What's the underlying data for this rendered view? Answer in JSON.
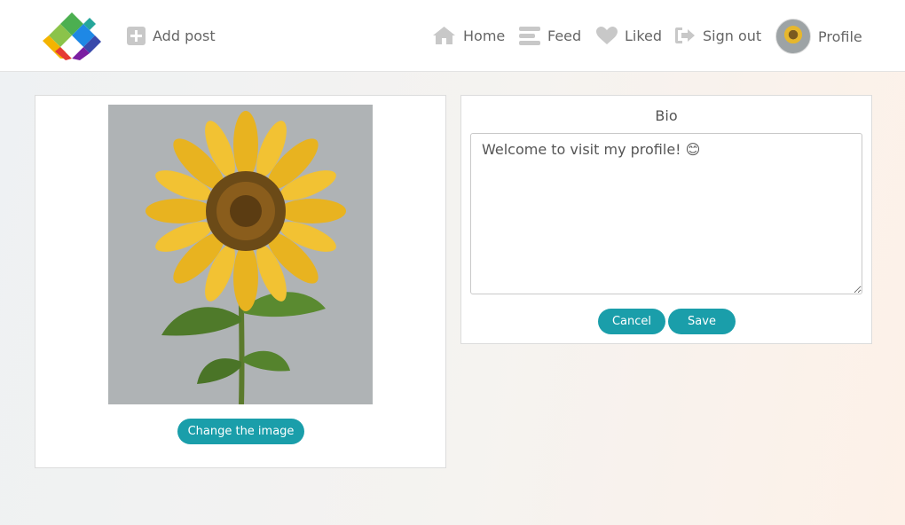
{
  "nav": {
    "add_post": "Add post",
    "home": "Home",
    "feed": "Feed",
    "liked": "Liked",
    "sign_out": "Sign out",
    "profile": "Profile"
  },
  "image_card": {
    "change_image_label": "Change the image"
  },
  "bio_card": {
    "title": "Bio",
    "text": "Welcome to visit my profile! 😊",
    "cancel_label": "Cancel",
    "save_label": "Save"
  },
  "colors": {
    "accent": "#1a9eaa",
    "nav_text": "#666666",
    "icon_gray": "#c8c8c8"
  },
  "icons": [
    "logo-icon",
    "plus-square-icon",
    "home-icon",
    "feed-icon",
    "heart-icon",
    "sign-out-icon"
  ]
}
